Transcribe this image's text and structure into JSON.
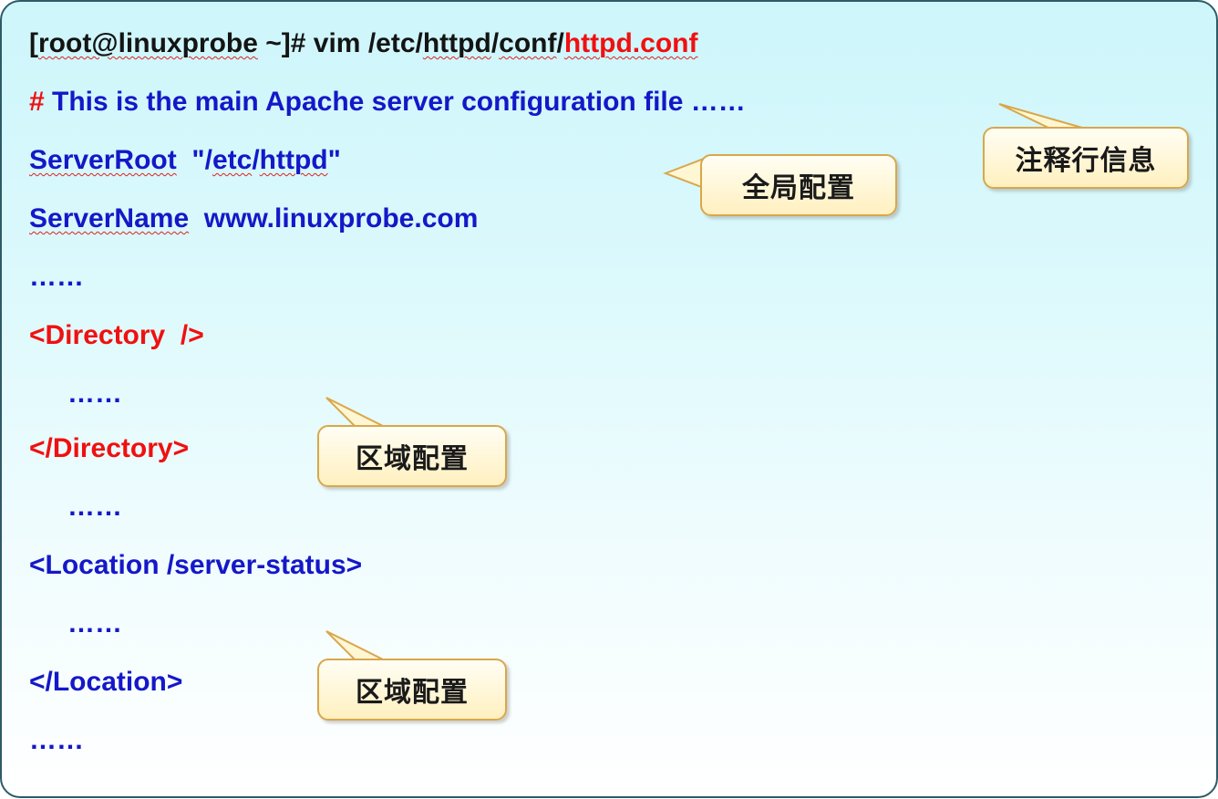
{
  "lines": {
    "cmd_prefix": "[",
    "cmd_root": "root@linuxprobe",
    "cmd_mid1": " ~]# vim /etc/",
    "cmd_httpd": "httpd",
    "cmd_slash1": "/",
    "cmd_conf": "conf",
    "cmd_slash2": "/",
    "cmd_file": "httpd.conf",
    "comment_hash": "# ",
    "comment_text": "This is the main Apache server configuration file ……",
    "serverroot_key": "ServerRoot",
    "serverroot_gap": "  \"/",
    "serverroot_etc": "etc",
    "serverroot_slash": "/",
    "serverroot_httpd": "httpd",
    "serverroot_end": "\"",
    "servername_key": "ServerName",
    "servername_val": "  www.linuxprobe.com",
    "dots1": "……",
    "dir_open": "<Directory  />",
    "dots2": "……",
    "dir_close": "</Directory>",
    "dots3": "……",
    "loc_open": "<Location /server-status>",
    "dots4": "……",
    "loc_close": "</Location>",
    "dots5": "……"
  },
  "callouts": {
    "comment": "注释行信息",
    "global": "全局配置",
    "region1": "区域配置",
    "region2": "区域配置"
  },
  "colors": {
    "blue_text": "#1418c8",
    "red_text": "#f01010",
    "black_text": "#141414",
    "callout_border": "#d9a74a",
    "callout_fill": "#fff0bf",
    "frame_border": "#2f5a67"
  }
}
